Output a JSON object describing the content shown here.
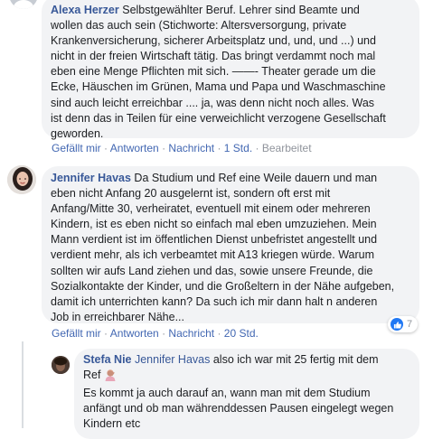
{
  "comments": [
    {
      "author": "Alexa Herzer",
      "text": "Selbstgewählter Beruf. Lehrer sind Beamte und\nwollen das auch sein (Stichworte: Altersversorgung, private\nKrankenversicherung, sicherer Arbeitsplatz und, und, und ...) und\nnicht in der freien Wirtschaft tätig. Das bringt verdammt noch mal\neben eine Menge Pflichten mit sich. ——- Theater gerade um die\nEcke, Häuschen im Grünen, Mama und Papa und Waschmaschine\nsind auch leicht erreichbar .... ja, was denn nicht noch alles. Was\nist denn das in Teilen für eine verweichlicht verzogene Gesellschaft\ngeworden.",
      "like_label": "Gefällt mir",
      "reply_label": "Antworten",
      "message_label": "Nachricht",
      "time": "1 Std.",
      "edited": "Bearbeitet"
    },
    {
      "author": "Jennifer Havas",
      "text": "Da Studium und Ref eine Weile dauern und man\neben nicht Anfang 20 ausgelernt ist, sondern oft erst mit\nAnfang/Mitte 30, verheiratet, eventuell mit einem oder mehreren\nKindern, ist es eben nicht so einfach mal eben umzuziehen. Mein\nMann verdient ist im öffentlichen Dienst unbefristet angestellt und\nverdient mehr, als ich verbeamtet mit A13 kriegen würde. Warum\nsollten wir aufs Land ziehen und das, sowie unsere Freunde, die\nSozialkontakte der Kinder, und die Großeltern in der Nähe aufgeben,\ndamit ich unterrichten kann? Da such ich mir dann halt n anderen\nJob in erreichbarer Nähe...",
      "like_label": "Gefällt mir",
      "reply_label": "Antworten",
      "message_label": "Nachricht",
      "time": "20 Std.",
      "reaction_count": "7"
    },
    {
      "author": "Stefa Nie",
      "mention": "Jennifer Havas",
      "text_line1": "also ich war mit 25 fertig mit dem",
      "text_line2": "Ref",
      "text_rest": "Es kommt ja auch darauf an, wann man mit dem Studium\nanfängt und ob man währenddessen Pausen eingelegt wegen\nKindern etc"
    }
  ],
  "separator": "·",
  "colors": {
    "link": "#385898",
    "action_link": "#4267b2",
    "bubble": "#f2f3f5",
    "meta": "#90949c",
    "like_blue": "#2078f4"
  },
  "icons": [
    "avatar",
    "like-icon",
    "facepalm-emoji-icon"
  ]
}
